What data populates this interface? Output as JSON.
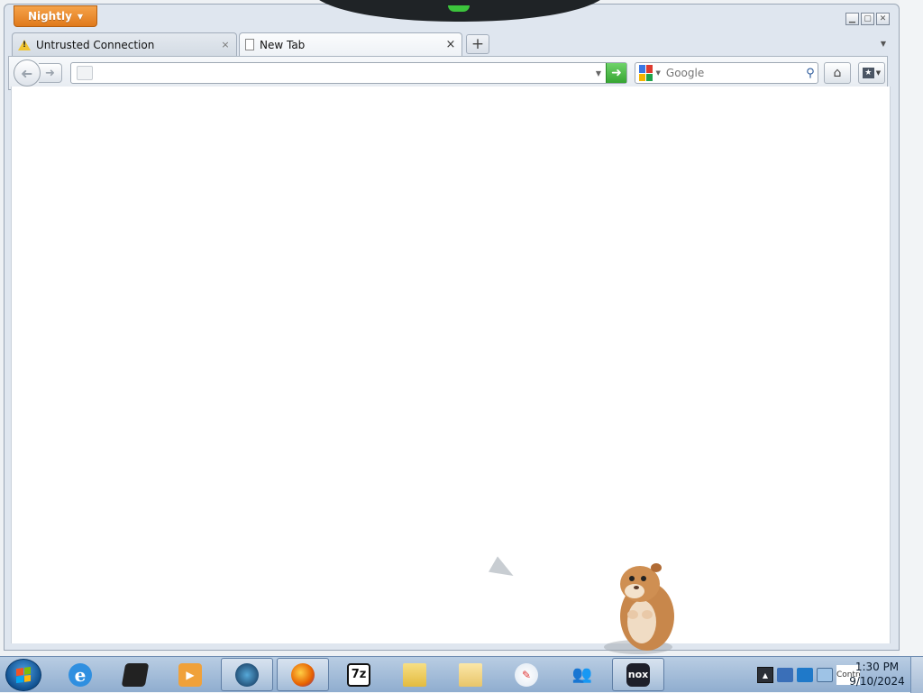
{
  "window": {
    "app_menu_label": "Nightly",
    "controls": {
      "minimize": "minimize",
      "maximize": "maximize",
      "close": "close"
    }
  },
  "tabs": [
    {
      "label": "Untrusted Connection",
      "icon": "warning-icon",
      "close": "×",
      "active": false
    },
    {
      "label": "New Tab",
      "icon": "page-icon",
      "close": "×",
      "active": true
    }
  ],
  "toolbar": {
    "back_icon": "back-arrow-icon",
    "forward_icon": "forward-arrow-icon",
    "url_value": "",
    "search_engine": "Google",
    "search_placeholder": "Google",
    "home_icon": "home-icon",
    "bookmarks_icon": "bookmarks-icon"
  },
  "taskbar": {
    "pinned": [
      {
        "name": "internet-explorer",
        "icon": "ie-icon",
        "running": false
      },
      {
        "name": "black-box-app",
        "icon": "box-icon",
        "running": false
      },
      {
        "name": "media-player",
        "icon": "media-player-icon",
        "running": false
      },
      {
        "name": "globe-app",
        "icon": "globe-icon",
        "running": true
      },
      {
        "name": "firefox-nightly",
        "icon": "firefox-icon",
        "running": true
      },
      {
        "name": "7zip",
        "icon": "7zip-icon",
        "running": false
      },
      {
        "name": "file-explorer",
        "icon": "folder-icon",
        "running": false
      },
      {
        "name": "card-app",
        "icon": "card-icon",
        "running": false
      },
      {
        "name": "paint",
        "icon": "paint-icon",
        "running": false
      },
      {
        "name": "people-app",
        "icon": "people-icon",
        "running": false
      },
      {
        "name": "nox",
        "icon": "nox-icon",
        "running": true
      }
    ],
    "tray_note": "Contro",
    "clock_time": "1:30 PM",
    "clock_date": "9/10/2024"
  },
  "glyphs": {
    "zip_label": "7z",
    "nox_label": "nox",
    "ie_label": "e"
  }
}
